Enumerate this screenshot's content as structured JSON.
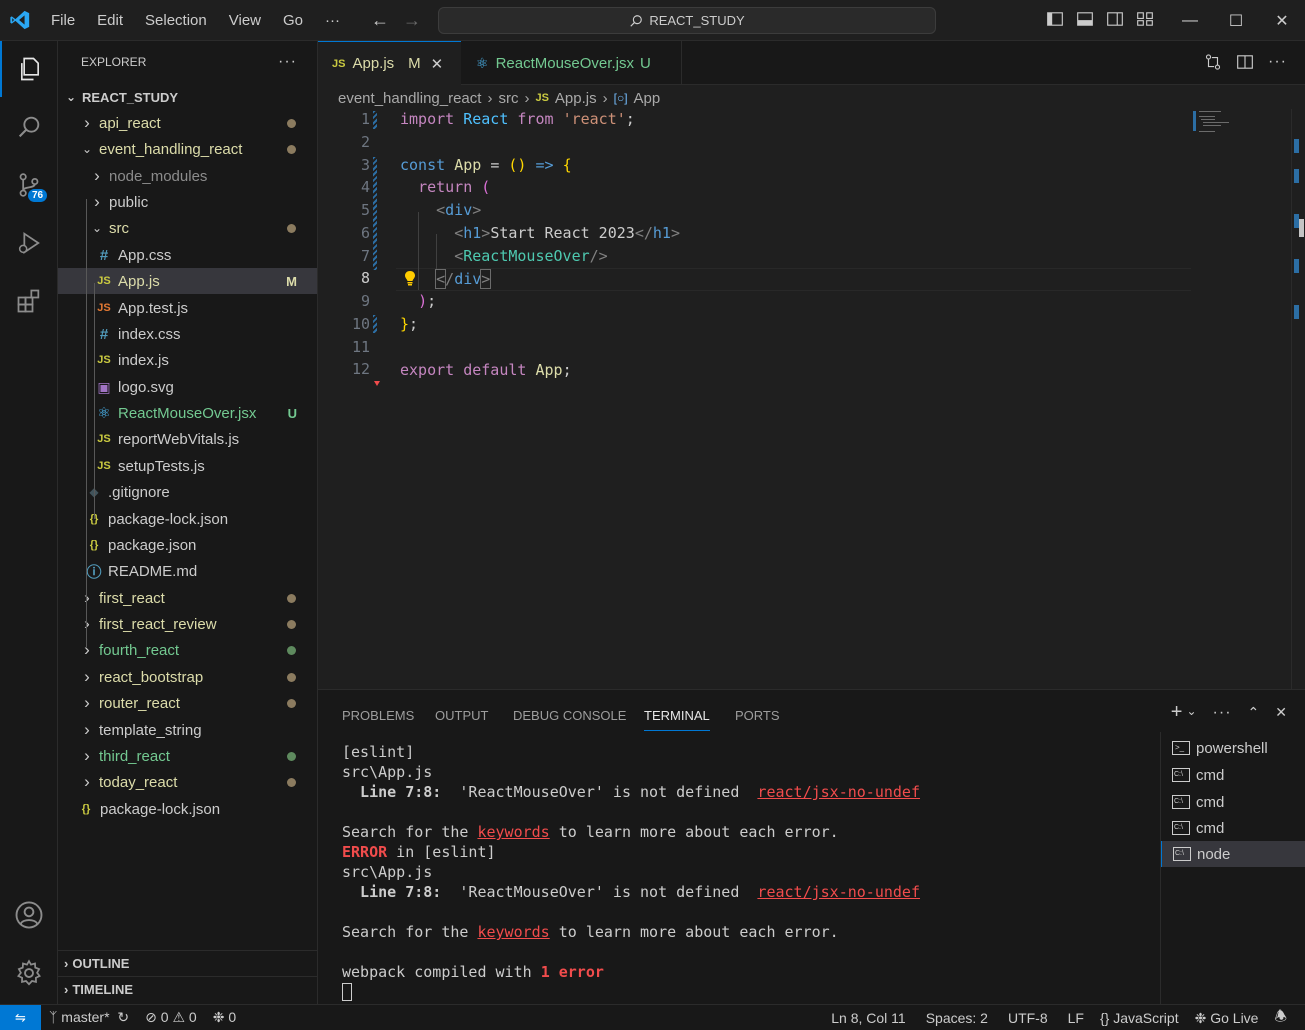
{
  "titlebar": {
    "menu": [
      "File",
      "Edit",
      "Selection",
      "View",
      "Go",
      "···"
    ],
    "search": "REACT_STUDY"
  },
  "activity": {
    "scm_badge": "76"
  },
  "explorer": {
    "title": "EXPLORER",
    "root": "REACT_STUDY",
    "items": [
      {
        "label": "api_react",
        "color": "#dcdcaa",
        "type": "folder",
        "open": false,
        "depth": 1,
        "dot": "mod"
      },
      {
        "label": "event_handling_react",
        "color": "#dcdcaa",
        "type": "folder",
        "open": true,
        "depth": 1,
        "dot": "mod"
      },
      {
        "label": "node_modules",
        "color": "#8c8c8c",
        "type": "folder",
        "open": false,
        "depth": 2
      },
      {
        "label": "public",
        "color": "#cccccc",
        "type": "folder",
        "open": false,
        "depth": 2
      },
      {
        "label": "src",
        "color": "#dcdcaa",
        "type": "folder",
        "open": true,
        "depth": 2,
        "dot": "mod"
      },
      {
        "label": "App.css",
        "color": "#cccccc",
        "type": "css",
        "depth": 3
      },
      {
        "label": "App.js",
        "color": "#dcdcaa",
        "type": "js",
        "depth": 3,
        "status": "M",
        "selected": true
      },
      {
        "label": "App.test.js",
        "color": "#cccccc",
        "type": "jsr",
        "depth": 3
      },
      {
        "label": "index.css",
        "color": "#cccccc",
        "type": "css",
        "depth": 3
      },
      {
        "label": "index.js",
        "color": "#cccccc",
        "type": "js",
        "depth": 3
      },
      {
        "label": "logo.svg",
        "color": "#cccccc",
        "type": "svg",
        "depth": 3
      },
      {
        "label": "ReactMouseOver.jsx",
        "color": "#73c991",
        "type": "react",
        "depth": 3,
        "status": "U"
      },
      {
        "label": "reportWebVitals.js",
        "color": "#cccccc",
        "type": "js",
        "depth": 3
      },
      {
        "label": "setupTests.js",
        "color": "#cccccc",
        "type": "js",
        "depth": 3
      },
      {
        "label": ".gitignore",
        "color": "#cccccc",
        "type": "git",
        "depth": 2
      },
      {
        "label": "package-lock.json",
        "color": "#cccccc",
        "type": "json",
        "depth": 2
      },
      {
        "label": "package.json",
        "color": "#cccccc",
        "type": "json",
        "depth": 2
      },
      {
        "label": "README.md",
        "color": "#cccccc",
        "type": "info",
        "depth": 2
      },
      {
        "label": "first_react",
        "color": "#dcdcaa",
        "type": "folder",
        "open": false,
        "depth": 1,
        "dot": "mod"
      },
      {
        "label": "first_react_review",
        "color": "#dcdcaa",
        "type": "folder",
        "open": false,
        "depth": 1,
        "dot": "mod"
      },
      {
        "label": "fourth_react",
        "color": "#73c991",
        "type": "folder",
        "open": false,
        "depth": 1,
        "dot": "new"
      },
      {
        "label": "react_bootstrap",
        "color": "#dcdcaa",
        "type": "folder",
        "open": false,
        "depth": 1,
        "dot": "mod"
      },
      {
        "label": "router_react",
        "color": "#dcdcaa",
        "type": "folder",
        "open": false,
        "depth": 1,
        "dot": "mod"
      },
      {
        "label": "template_string",
        "color": "#cccccc",
        "type": "folder",
        "open": false,
        "depth": 1
      },
      {
        "label": "third_react",
        "color": "#73c991",
        "type": "folder",
        "open": false,
        "depth": 1,
        "dot": "new"
      },
      {
        "label": "today_react",
        "color": "#dcdcaa",
        "type": "folder",
        "open": false,
        "depth": 1,
        "dot": "mod"
      },
      {
        "label": "package-lock.json",
        "color": "#cccccc",
        "type": "json",
        "depth": 0
      }
    ],
    "outline": "OUTLINE",
    "timeline": "TIMELINE"
  },
  "tabs": [
    {
      "label": "App.js",
      "status": "M",
      "active": true
    },
    {
      "label": "ReactMouseOver.jsx",
      "status": "U",
      "active": false
    }
  ],
  "breadcrumb": [
    "event_handling_react",
    "src",
    "App.js",
    "App"
  ],
  "code": {
    "line_numbers": [
      "1",
      "2",
      "3",
      "4",
      "5",
      "6",
      "7",
      "8",
      "9",
      "10",
      "11",
      "12"
    ],
    "current_line": "8"
  },
  "panel": {
    "tabs": [
      "PROBLEMS",
      "OUTPUT",
      "DEBUG CONSOLE",
      "TERMINAL",
      "PORTS"
    ],
    "active_tab": "TERMINAL",
    "terminal": {
      "l1": "[eslint]",
      "l2": "src\\App.js",
      "l3_a": "  Line 7:8:",
      "l3_b": "  'ReactMouseOver' is not defined  ",
      "l3_c": "react/jsx-no-undef",
      "l5_a": "Search for the ",
      "l5_b": "keywords",
      "l5_c": " to learn more about each error.",
      "l6_a": "ERROR",
      "l6_b": " in [eslint]",
      "l7": "src\\App.js",
      "l8_a": "  Line 7:8:",
      "l8_b": "  'ReactMouseOver' is not defined  ",
      "l8_c": "react/jsx-no-undef",
      "l10_a": "Search for the ",
      "l10_b": "keywords",
      "l10_c": " to learn more about each error.",
      "l12_a": "webpack compiled with ",
      "l12_b": "1 error"
    },
    "terminals": [
      "powershell",
      "cmd",
      "cmd",
      "cmd",
      "node"
    ]
  },
  "status": {
    "branch": "master*",
    "errors": "0",
    "warnings": "0",
    "ports": "0",
    "position": "Ln 8, Col 11",
    "spaces": "Spaces: 2",
    "encoding": "UTF-8",
    "eol": "LF",
    "language": "JavaScript",
    "golive": "Go Live"
  },
  "colors": {
    "accent": "#0078d4",
    "modified": "#dcdcaa",
    "untracked": "#73c991",
    "error": "#f14c4c"
  }
}
